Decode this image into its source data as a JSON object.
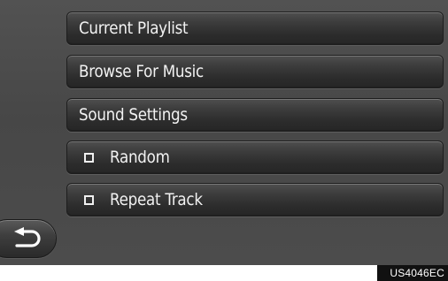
{
  "menu": {
    "items": [
      {
        "label": "Current Playlist"
      },
      {
        "label": "Browse For Music"
      },
      {
        "label": "Sound Settings"
      }
    ],
    "toggles": [
      {
        "label": "Random",
        "checked": false
      },
      {
        "label": "Repeat Track",
        "checked": false
      }
    ]
  },
  "back_button": {
    "icon": "back-arrow-icon"
  },
  "footer": {
    "figure_code": "US4046EC"
  }
}
